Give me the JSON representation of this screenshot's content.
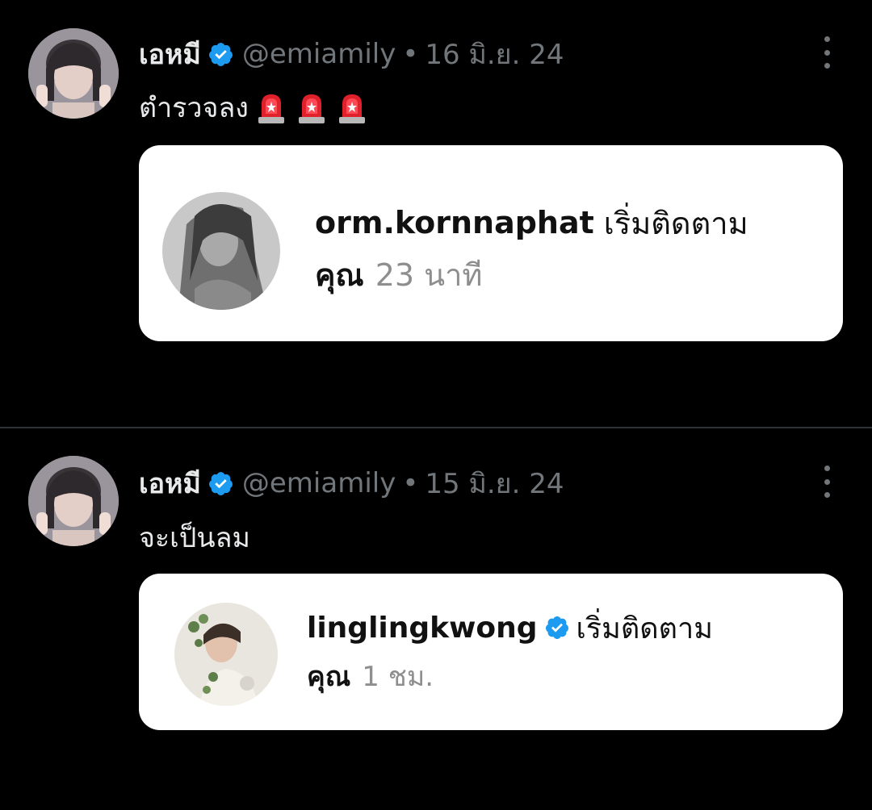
{
  "tweets": [
    {
      "author_name": "เอหมี",
      "handle": "@emiamily",
      "separator": "•",
      "date": "16 มิ.ย. 24",
      "text": "ตำรวจลง",
      "emoji": "🚨🚨🚨",
      "card": {
        "username": "orm.kornnaphat",
        "action": "เริ่มติดตาม",
        "you_label": "คุณ",
        "time_ago": "23 นาที",
        "verified": false
      }
    },
    {
      "author_name": "เอหมี",
      "handle": "@emiamily",
      "separator": "•",
      "date": "15 มิ.ย. 24",
      "text": "จะเป็นลม",
      "card": {
        "username": "linglingkwong",
        "action": "เริ่มติดตาม",
        "you_label": "คุณ",
        "time_ago": "1 ชม.",
        "verified": true
      }
    }
  ],
  "icons": {
    "verified": "verified-badge-icon",
    "more": "more-options-icon",
    "siren": "police-siren-icon"
  },
  "colors": {
    "background": "#000000",
    "primary_text": "#e7e9ea",
    "secondary_text": "#71767b",
    "verified_blue": "#1d9bf0",
    "card_background": "#ffffff"
  }
}
